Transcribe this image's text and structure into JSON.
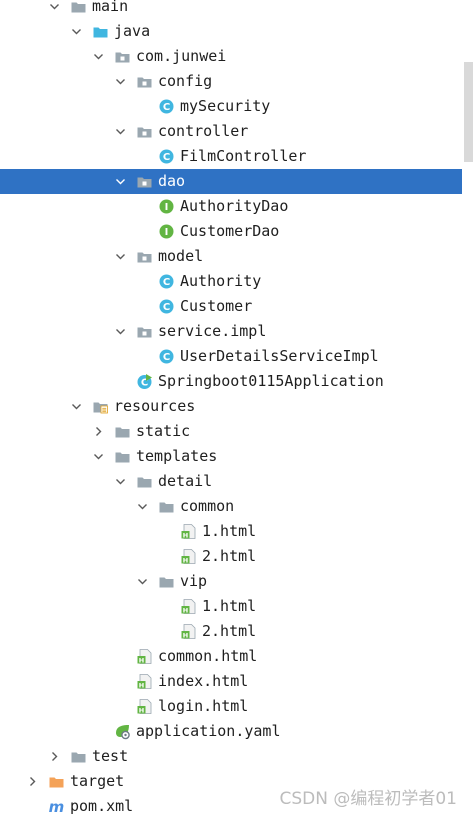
{
  "colors": {
    "selection": "#2f72c4",
    "folder": "#9aa7b0",
    "folder_dark": "#6e7b85",
    "java_folder": "#40b6e0",
    "class_badge": "#40b6e0",
    "interface_badge": "#62b543",
    "target_folder": "#f4a258",
    "html_badge": "#62b543"
  },
  "tree": [
    {
      "label": "main",
      "depth": 1,
      "arrow": "down",
      "icon": "folder-icon"
    },
    {
      "label": "java",
      "depth": 2,
      "arrow": "down",
      "icon": "java-source-folder-icon"
    },
    {
      "label": "com.junwei",
      "depth": 3,
      "arrow": "down",
      "icon": "package-icon"
    },
    {
      "label": "config",
      "depth": 4,
      "arrow": "down",
      "icon": "package-icon"
    },
    {
      "label": "mySecurity",
      "depth": 5,
      "arrow": "none",
      "icon": "class-icon"
    },
    {
      "label": "controller",
      "depth": 4,
      "arrow": "down",
      "icon": "package-icon"
    },
    {
      "label": "FilmController",
      "depth": 5,
      "arrow": "none",
      "icon": "class-icon"
    },
    {
      "label": "dao",
      "depth": 4,
      "arrow": "down",
      "icon": "package-icon",
      "selected": true
    },
    {
      "label": "AuthorityDao",
      "depth": 5,
      "arrow": "none",
      "icon": "interface-icon"
    },
    {
      "label": "CustomerDao",
      "depth": 5,
      "arrow": "none",
      "icon": "interface-icon"
    },
    {
      "label": "model",
      "depth": 4,
      "arrow": "down",
      "icon": "package-icon"
    },
    {
      "label": "Authority",
      "depth": 5,
      "arrow": "none",
      "icon": "class-icon"
    },
    {
      "label": "Customer",
      "depth": 5,
      "arrow": "none",
      "icon": "class-icon"
    },
    {
      "label": "service.impl",
      "depth": 4,
      "arrow": "down",
      "icon": "package-icon"
    },
    {
      "label": "UserDetailsServiceImpl",
      "depth": 5,
      "arrow": "none",
      "icon": "class-icon"
    },
    {
      "label": "Springboot0115Application",
      "depth": 4,
      "arrow": "none",
      "icon": "spring-boot-class-icon"
    },
    {
      "label": "resources",
      "depth": 2,
      "arrow": "down",
      "icon": "resources-folder-icon"
    },
    {
      "label": "static",
      "depth": 3,
      "arrow": "right",
      "icon": "folder-icon"
    },
    {
      "label": "templates",
      "depth": 3,
      "arrow": "down",
      "icon": "folder-icon"
    },
    {
      "label": "detail",
      "depth": 4,
      "arrow": "down",
      "icon": "folder-icon"
    },
    {
      "label": "common",
      "depth": 5,
      "arrow": "down",
      "icon": "folder-icon"
    },
    {
      "label": "1.html",
      "depth": 6,
      "arrow": "none",
      "icon": "html-file-icon"
    },
    {
      "label": "2.html",
      "depth": 6,
      "arrow": "none",
      "icon": "html-file-icon"
    },
    {
      "label": "vip",
      "depth": 5,
      "arrow": "down",
      "icon": "folder-icon"
    },
    {
      "label": "1.html",
      "depth": 6,
      "arrow": "none",
      "icon": "html-file-icon"
    },
    {
      "label": "2.html",
      "depth": 6,
      "arrow": "none",
      "icon": "html-file-icon"
    },
    {
      "label": "common.html",
      "depth": 4,
      "arrow": "none",
      "icon": "html-file-icon"
    },
    {
      "label": "index.html",
      "depth": 4,
      "arrow": "none",
      "icon": "html-file-icon"
    },
    {
      "label": "login.html",
      "depth": 4,
      "arrow": "none",
      "icon": "html-file-icon"
    },
    {
      "label": "application.yaml",
      "depth": 3,
      "arrow": "none",
      "icon": "spring-config-file-icon"
    },
    {
      "label": "test",
      "depth": 1,
      "arrow": "right",
      "icon": "folder-icon"
    },
    {
      "label": "target",
      "depth": 0,
      "arrow": "right",
      "icon": "excluded-folder-icon"
    },
    {
      "label": "pom.xml",
      "depth": 0,
      "arrow": "none",
      "icon": "maven-file-icon"
    }
  ],
  "watermark": "CSDN @编程初学者01"
}
